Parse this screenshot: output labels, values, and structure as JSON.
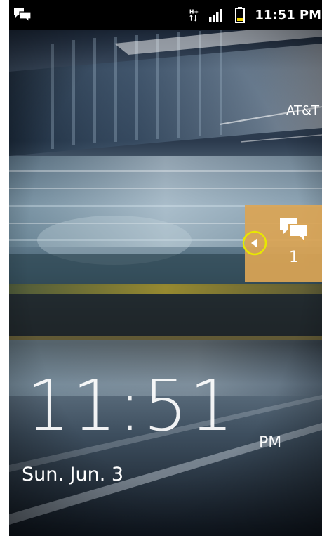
{
  "status_bar": {
    "left_icon": "chat-bubbles-icon",
    "network_type": "H+",
    "signal_icon": "signal-bars-icon",
    "battery_icon": "battery-icon",
    "battery_color": "#f2d400",
    "time": "11:51 PM"
  },
  "lockscreen": {
    "carrier": "AT&T",
    "time": "11:51",
    "ampm": "PM",
    "date": "Sun. Jun. 3"
  },
  "notification_tab": {
    "icon": "chat-bubbles-icon",
    "count": "1",
    "color": "#daa555",
    "arrow_icon": "left-arrow-icon",
    "highlight_color": "#e8e800"
  }
}
